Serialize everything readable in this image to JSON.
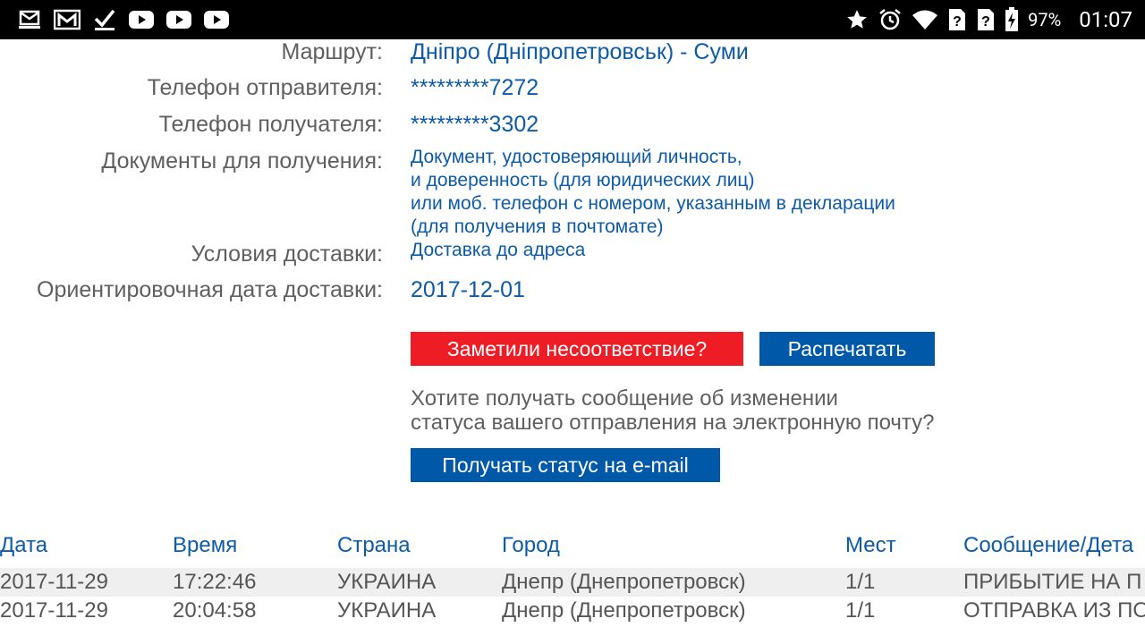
{
  "status_bar": {
    "battery": "97%",
    "time": "01:07"
  },
  "info": {
    "route_label": "Маршрут:",
    "route_value": "Дніпро (Дніпропетровськ) - Суми",
    "sender_phone_label": "Телефон отправителя:",
    "sender_phone_value": "*********7272",
    "receiver_phone_label": "Телефон получателя:",
    "receiver_phone_value": "*********3302",
    "documents_label": "Документы для получения:",
    "documents_lines": [
      "Документ, удостоверяющий личность,",
      "и доверенность (для юридических лиц)",
      "или моб. телефон с номером, указанным в декларации",
      "(для получения в почтомате)"
    ],
    "delivery_terms_label": "Условия доставки:",
    "delivery_terms_value": "Доставка до адреса",
    "est_date_label": "Ориентировочная дата доставки:",
    "est_date_value": "2017-12-01"
  },
  "actions": {
    "mismatch_button": "Заметили несоответствие?",
    "print_button": "Распечатать",
    "question_lines": [
      "Хотите получать сообщение об изменении",
      "статуса вашего отправления на электронную почту?"
    ],
    "email_button": "Получать статус на e-mail"
  },
  "table": {
    "headers": [
      "Дата",
      "Время",
      "Страна",
      "Город",
      "Мест",
      "Сообщение/Дета"
    ],
    "rows": [
      [
        "2017-11-29",
        "17:22:46",
        "УКРАИНА",
        "Днепр (Днепропетровск)",
        "1/1",
        "ПРИБЫТИЕ НА П"
      ],
      [
        "2017-11-29",
        "20:04:58",
        "УКРАИНА",
        "Днепр (Днепропетровск)",
        "1/1",
        "ОТПРАВКА ИЗ ПО"
      ]
    ]
  },
  "colors": {
    "accent_blue": "#0d5ba6",
    "button_blue": "#0058a8",
    "button_red": "#ee1c25"
  }
}
